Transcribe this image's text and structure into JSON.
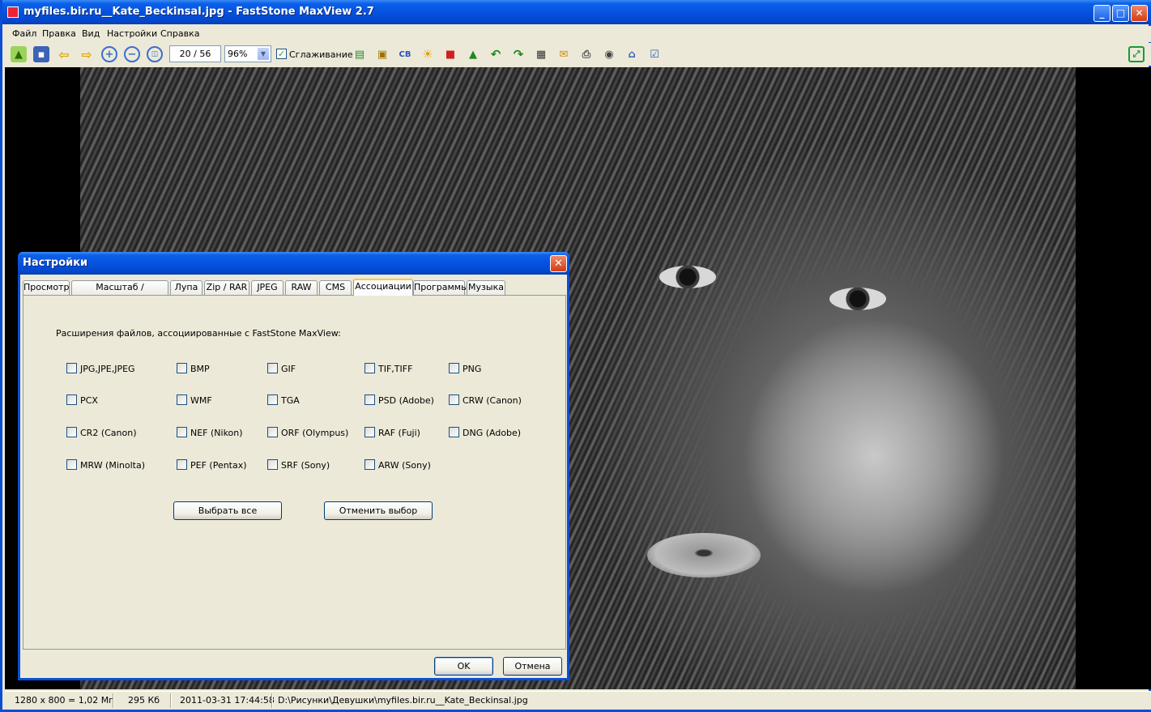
{
  "window": {
    "title": "myfiles.bir.ru__Kate_Beckinsal.jpg - FastStone MaxView 2.7"
  },
  "menu": [
    "Файл",
    "Правка",
    "Вид",
    "Настройки",
    "Справка"
  ],
  "toolbar": {
    "counter": "20 / 56",
    "zoom": "96%",
    "smoothing_label": "Сглаживание",
    "smoothing_checked": true
  },
  "status": {
    "dimensions": "1280 x 800 = 1,02 Мп",
    "size": "295 Кб",
    "date": "2011-03-31 17:44:58",
    "path": "D:\\Рисунки\\Девушки\\myfiles.bir.ru__Kate_Beckinsal.jpg"
  },
  "dialog": {
    "title": "Настройки",
    "close": "✕",
    "tabs": [
      "Просмотр",
      "Масштаб / Прокрутка",
      "Лупа",
      "Zip / RAR",
      "JPEG",
      "RAW",
      "CMS",
      "Ассоциации",
      "Программы",
      "Музыка"
    ],
    "active_tab": "Ассоциации",
    "caption": "Расширения файлов, ассоциированные с FastStone MaxView:",
    "extensions": [
      [
        "JPG,JPE,JPEG",
        "BMP",
        "GIF",
        "TIF,TIFF",
        "PNG"
      ],
      [
        "PCX",
        "WMF",
        "TGA",
        "PSD (Adobe)",
        "CRW (Canon)"
      ],
      [
        "CR2 (Canon)",
        "NEF (Nikon)",
        "ORF (Olympus)",
        "RAF (Fuji)",
        "DNG (Adobe)"
      ],
      [
        "MRW (Minolta)",
        "PEF (Pentax)",
        "SRF (Sony)",
        "ARW (Sony)"
      ]
    ],
    "select_all": "Выбрать все",
    "deselect": "Отменить выбор",
    "ok": "OK",
    "cancel": "Отмена"
  }
}
